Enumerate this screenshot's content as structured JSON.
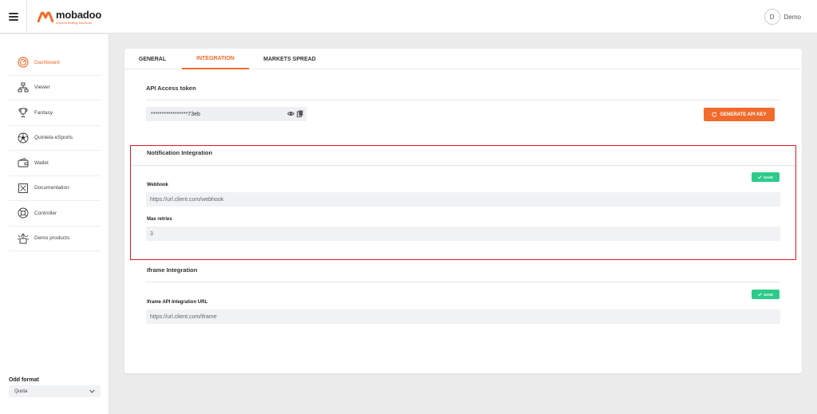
{
  "header": {
    "logo_name": "mobadoo",
    "logo_tagline": "eSports Betting Solutions",
    "user_initial": "D",
    "user_name": "Demo",
    "brand_color": "#f26b2c"
  },
  "sidebar": {
    "items": [
      {
        "label": "Dashboard",
        "icon": "dashboard-icon",
        "active": true
      },
      {
        "label": "Viewer",
        "icon": "viewer-icon",
        "active": false
      },
      {
        "label": "Fantasy",
        "icon": "trophy-icon",
        "active": false
      },
      {
        "label": "Quiniela eSports",
        "icon": "ball-icon",
        "active": false
      },
      {
        "label": "Wallet",
        "icon": "wallet-icon",
        "active": false
      },
      {
        "label": "Documentation",
        "icon": "documentation-icon",
        "active": false
      },
      {
        "label": "Controller",
        "icon": "lifebuoy-icon",
        "active": false
      },
      {
        "label": "Demo products",
        "icon": "demo-box-icon",
        "active": false
      }
    ],
    "odd_format": {
      "title": "Odd format",
      "value": "Quota"
    }
  },
  "tabs": [
    {
      "label": "GENERAL",
      "active": false
    },
    {
      "label": "INTEGRATION",
      "active": true
    },
    {
      "label": "MARKETS SPREAD",
      "active": false
    }
  ],
  "api": {
    "title": "API Access token",
    "token": "*****************73eb",
    "generate_label": "GENERATE API KEY"
  },
  "notification": {
    "title": "Notification Integration",
    "save_label": "SAVE",
    "webhook_label": "Webhook",
    "webhook_value": "https://url.client.com/webhook",
    "retries_label": "Max retries",
    "retries_value": "3"
  },
  "iframe": {
    "title": "Iframe Integration",
    "save_label": "SAVE",
    "url_label": "Iframe API Integration URL",
    "url_value": "https://url.client.com/iframe"
  }
}
